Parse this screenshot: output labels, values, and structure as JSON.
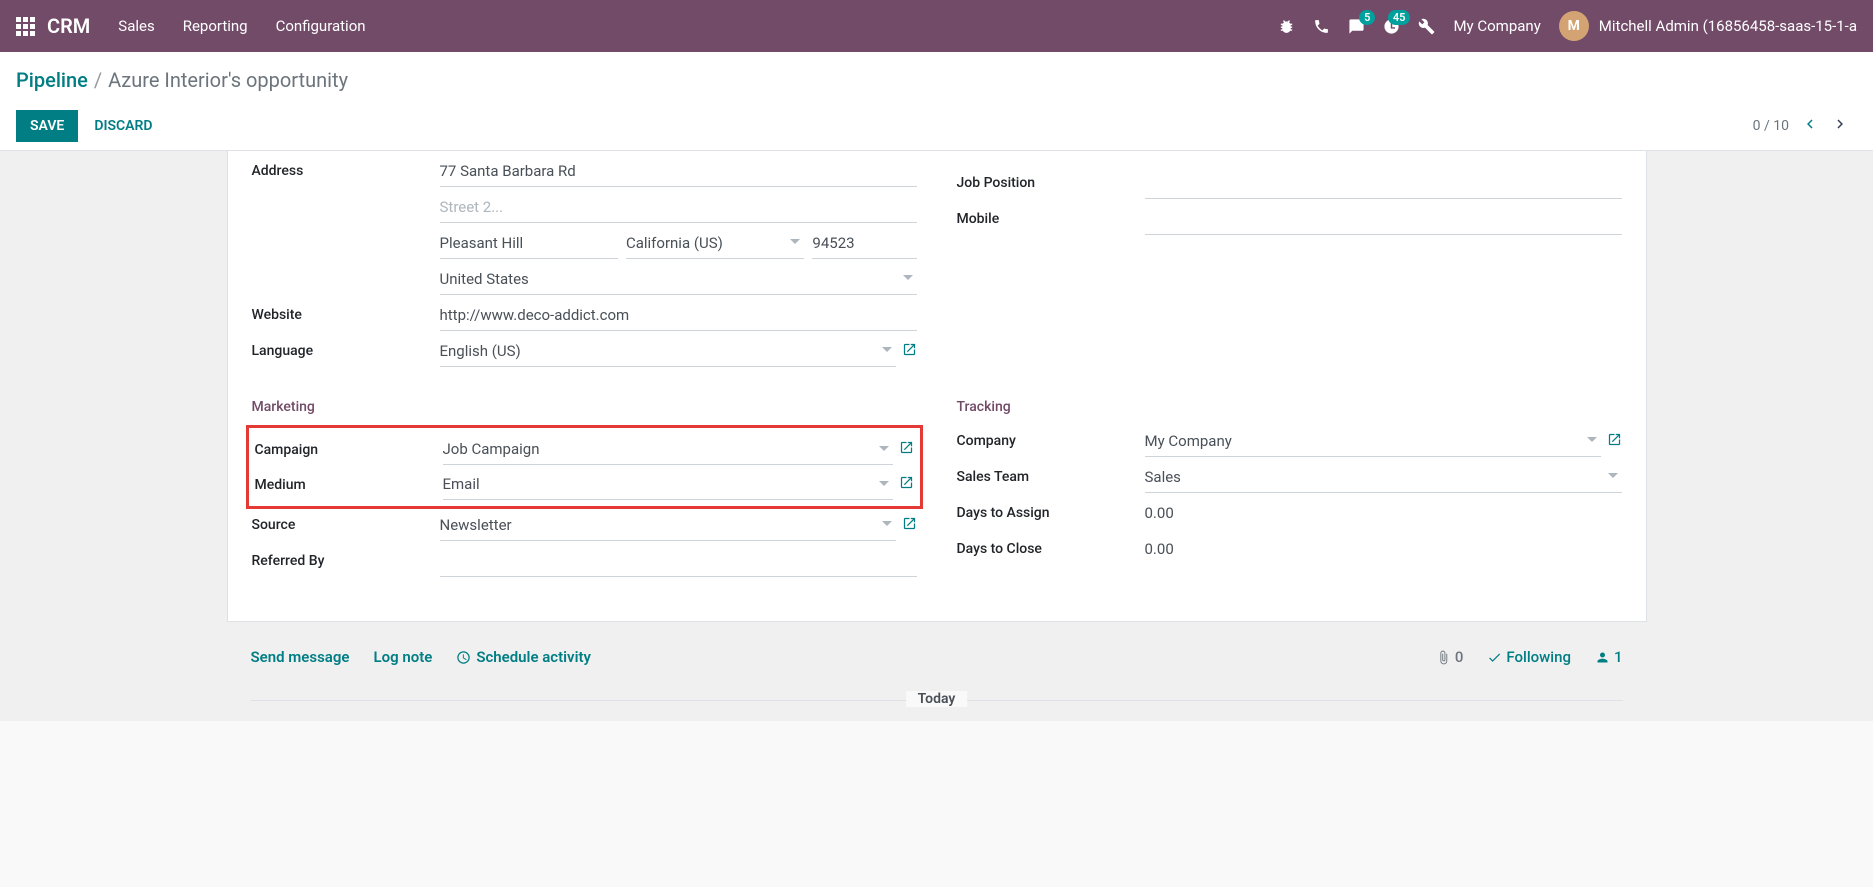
{
  "header": {
    "brand": "CRM",
    "nav": [
      "Sales",
      "Reporting",
      "Configuration"
    ],
    "chat_badge": "5",
    "activity_badge": "45",
    "company": "My Company",
    "avatar_initials": "M",
    "user": "Mitchell Admin (16856458-saas-15-1-a"
  },
  "breadcrumb": {
    "root": "Pipeline",
    "current": "Azure Interior's opportunity"
  },
  "actions": {
    "save": "SAVE",
    "discard": "DISCARD",
    "pager": "0 / 10"
  },
  "form": {
    "left": {
      "address_label": "Address",
      "street": "77 Santa Barbara Rd",
      "street2_placeholder": "Street 2...",
      "city": "Pleasant Hill",
      "state": "California (US)",
      "zip": "94523",
      "country": "United States",
      "website_label": "Website",
      "website": "http://www.deco-addict.com",
      "language_label": "Language",
      "language": "English (US)"
    },
    "right": {
      "job_label": "Job Position",
      "job": "",
      "mobile_label": "Mobile",
      "mobile": ""
    },
    "marketing": {
      "title": "Marketing",
      "campaign_label": "Campaign",
      "campaign": "Job Campaign",
      "medium_label": "Medium",
      "medium": "Email",
      "source_label": "Source",
      "source": "Newsletter",
      "referred_label": "Referred By",
      "referred": ""
    },
    "tracking": {
      "title": "Tracking",
      "company_label": "Company",
      "company": "My Company",
      "team_label": "Sales Team",
      "team": "Sales",
      "assign_label": "Days to Assign",
      "assign": "0.00",
      "close_label": "Days to Close",
      "close": "0.00"
    }
  },
  "chatter": {
    "send": "Send message",
    "log": "Log note",
    "schedule": "Schedule activity",
    "attach_count": "0",
    "following": "Following",
    "people_count": "1",
    "today": "Today"
  }
}
